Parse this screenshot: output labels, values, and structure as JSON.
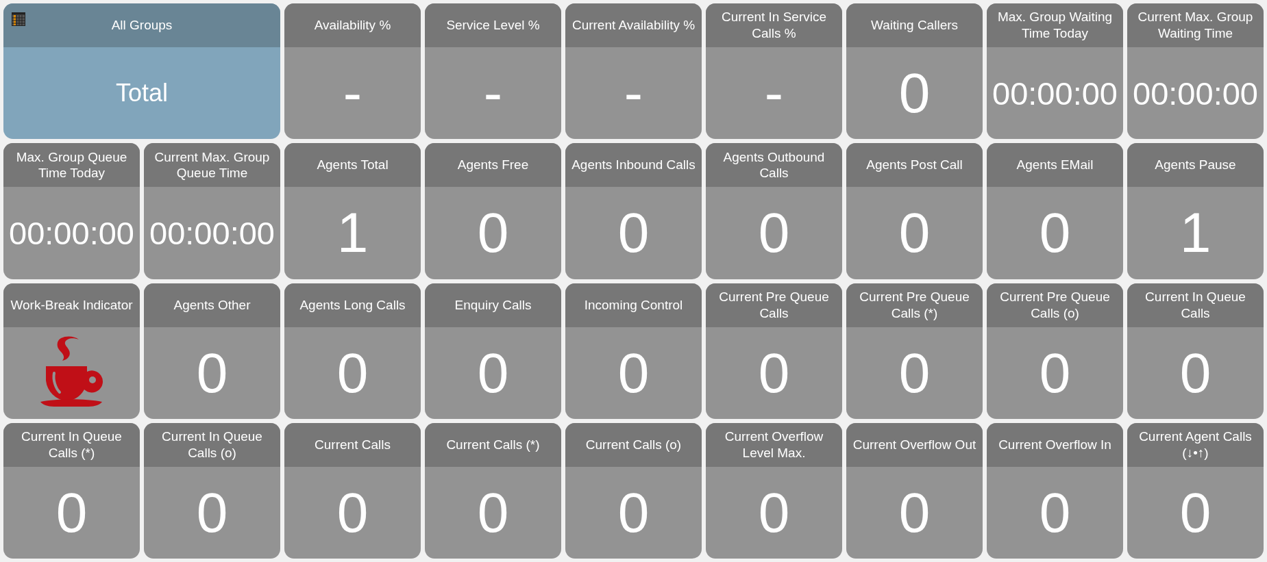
{
  "tiles": [
    {
      "kind": "summary",
      "label": "All Groups",
      "value": "Total"
    },
    {
      "kind": "metric",
      "label": "Availability %",
      "value": "-"
    },
    {
      "kind": "metric",
      "label": "Service Level %",
      "value": "-"
    },
    {
      "kind": "metric",
      "label": "Current Availability %",
      "value": "-"
    },
    {
      "kind": "metric",
      "label": "Current In Service Calls %",
      "value": "-"
    },
    {
      "kind": "metric",
      "label": "Waiting Callers",
      "value": "0"
    },
    {
      "kind": "time",
      "label": "Max. Group Waiting Time Today",
      "value": "00:00:00"
    },
    {
      "kind": "time",
      "label": "Current Max. Group Waiting Time",
      "value": "00:00:00"
    },
    {
      "kind": "time",
      "label": "Max. Group Queue Time Today",
      "value": "00:00:00"
    },
    {
      "kind": "time",
      "label": "Current Max. Group Queue Time",
      "value": "00:00:00"
    },
    {
      "kind": "metric",
      "label": "Agents Total",
      "value": "1"
    },
    {
      "kind": "metric",
      "label": "Agents Free",
      "value": "0"
    },
    {
      "kind": "metric",
      "label": "Agents Inbound Calls",
      "value": "0"
    },
    {
      "kind": "metric",
      "label": "Agents Outbound Calls",
      "value": "0"
    },
    {
      "kind": "metric",
      "label": "Agents Post Call",
      "value": "0"
    },
    {
      "kind": "metric",
      "label": "Agents EMail",
      "value": "0"
    },
    {
      "kind": "metric",
      "label": "Agents Pause",
      "value": "1"
    },
    {
      "kind": "indicator",
      "label": "Work-Break Indicator",
      "on": true
    },
    {
      "kind": "metric",
      "label": "Agents Other",
      "value": "0"
    },
    {
      "kind": "metric",
      "label": "Agents Long Calls",
      "value": "0"
    },
    {
      "kind": "metric",
      "label": "Enquiry Calls",
      "value": "0"
    },
    {
      "kind": "metric",
      "label": "Incoming Control",
      "value": "0"
    },
    {
      "kind": "metric",
      "label": "Current Pre Queue Calls",
      "value": "0"
    },
    {
      "kind": "metric",
      "label": "Current Pre Queue Calls (*)",
      "value": "0"
    },
    {
      "kind": "metric",
      "label": "Current Pre Queue Calls (o)",
      "value": "0"
    },
    {
      "kind": "metric",
      "label": "Current In Queue Calls",
      "value": "0"
    },
    {
      "kind": "metric",
      "label": "Current In Queue Calls (*)",
      "value": "0"
    },
    {
      "kind": "metric",
      "label": "Current In Queue Calls (o)",
      "value": "0"
    },
    {
      "kind": "metric",
      "label": "Current Calls",
      "value": "0"
    },
    {
      "kind": "metric",
      "label": "Current Calls (*)",
      "value": "0"
    },
    {
      "kind": "metric",
      "label": "Current Calls (o)",
      "value": "0"
    },
    {
      "kind": "metric",
      "label": "Current Overflow Level Max.",
      "value": "0"
    },
    {
      "kind": "metric",
      "label": "Current Overflow Out",
      "value": "0"
    },
    {
      "kind": "metric",
      "label": "Current Overflow In",
      "value": "0"
    },
    {
      "kind": "metric",
      "label": "Current Agent Calls (↓•↑)",
      "value": "0"
    }
  ]
}
